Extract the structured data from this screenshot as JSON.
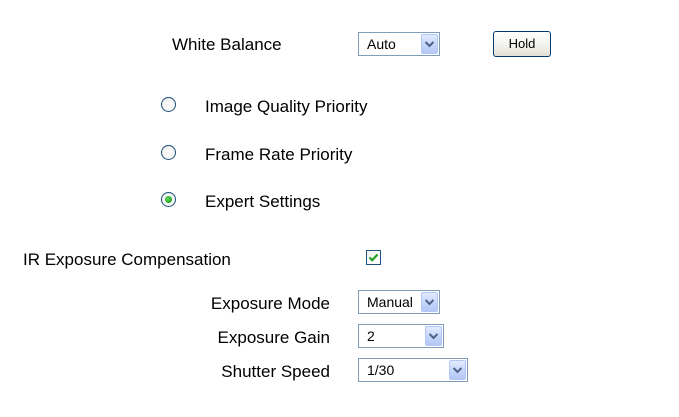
{
  "white_balance": {
    "label": "White Balance",
    "selected": "Auto",
    "hold_button": "Hold"
  },
  "priority_options": [
    {
      "label": "Image Quality Priority",
      "checked": false
    },
    {
      "label": "Frame Rate Priority",
      "checked": false
    },
    {
      "label": "Expert Settings",
      "checked": true
    }
  ],
  "ir_exposure_compensation": {
    "label": "IR Exposure Compensation",
    "checked": true
  },
  "exposure_mode": {
    "label": "Exposure Mode",
    "selected": "Manual"
  },
  "exposure_gain": {
    "label": "Exposure Gain",
    "selected": "2"
  },
  "shutter_speed": {
    "label": "Shutter Speed",
    "selected": "1/30"
  },
  "colors": {
    "control_border": "#7f9db9",
    "radio_border": "#1c5180",
    "check_green": "#21a121",
    "button_border": "#003c74"
  },
  "icons": {
    "dropdown": "chevron-down-icon",
    "check": "checkmark-icon",
    "radio_dot": "radio-dot-icon"
  }
}
